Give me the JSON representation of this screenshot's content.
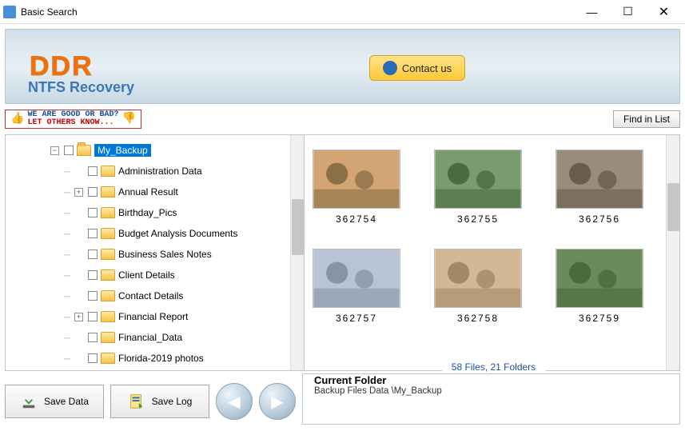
{
  "window": {
    "title": "Basic Search"
  },
  "banner": {
    "logo": "DDR",
    "subtitle": "NTFS Recovery",
    "contact": "Contact us"
  },
  "feedback": {
    "line1": "WE ARE GOOD OR BAD?",
    "line2": "LET OTHERS KNOW..."
  },
  "toolbar": {
    "find": "Find in List"
  },
  "tree": {
    "root": "My_Backup",
    "items": [
      "Administration Data",
      "Annual Result",
      "Birthday_Pics",
      "Budget Analysis Documents",
      "Business Sales Notes",
      "Client Details",
      "Contact Details",
      "Financial Report",
      "Financial_Data",
      "Florida-2019 photos"
    ],
    "expandable": [
      1,
      7
    ]
  },
  "thumbs": [
    "362754",
    "362755",
    "362756",
    "362757",
    "362758",
    "362759"
  ],
  "footer": {
    "save_data": "Save Data",
    "save_log": "Save Log",
    "stats": "58 Files,  21 Folders",
    "current_hdr": "Current Folder",
    "current_path": "Backup Files Data \\My_Backup"
  }
}
